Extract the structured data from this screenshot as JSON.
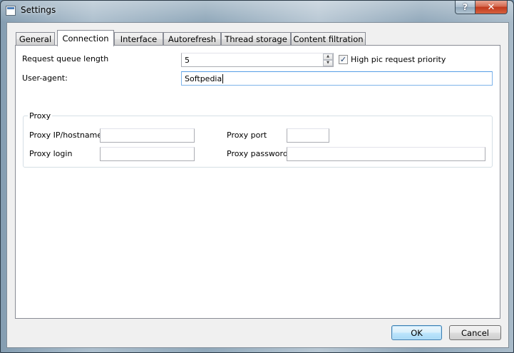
{
  "window": {
    "title": "Settings",
    "help_label": "?",
    "close_label": "✕"
  },
  "tabs": [
    {
      "label": "General"
    },
    {
      "label": "Connection",
      "active": true
    },
    {
      "label": "Interface"
    },
    {
      "label": "Autorefresh"
    },
    {
      "label": "Thread storage"
    },
    {
      "label": "Content filtration"
    }
  ],
  "connection": {
    "request_queue_label": "Request queue length",
    "request_queue_value": "5",
    "high_pic_label": "High pic request priority",
    "high_pic_checked": true,
    "check_mark": "✓",
    "user_agent_label": "User-agent:",
    "user_agent_value": "Softpedia"
  },
  "proxy": {
    "group_label": "Proxy",
    "ip_label": "Proxy IP/hostname",
    "ip_value": "",
    "port_label": "Proxy port",
    "port_value": "",
    "login_label": "Proxy login",
    "login_value": "",
    "password_label": "Proxy password",
    "password_value": ""
  },
  "buttons": {
    "ok_label": "OK",
    "cancel_label": "Cancel"
  },
  "icons": {
    "spin_up": "▲",
    "spin_down": "▼"
  }
}
